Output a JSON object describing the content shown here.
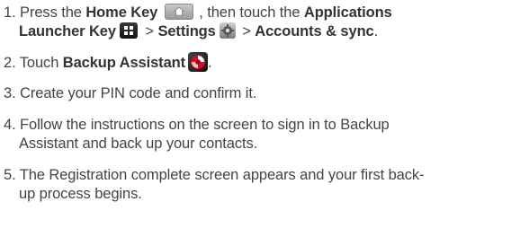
{
  "steps": [
    {
      "num": "1.",
      "pre": "Press the ",
      "home_key": "Home Key",
      "mid1": ", then touch the ",
      "apps_label": "Applications",
      "line2_apps": "Launcher Key",
      "sep1": " > ",
      "settings": "Settings",
      "sep2": " > ",
      "accounts": "Accounts & sync",
      "end": "."
    },
    {
      "num": "2.",
      "pre": "Touch ",
      "backup": "Backup Assistant",
      "end": "."
    },
    {
      "num": "3.",
      "text": "Create your PIN code and confirm it."
    },
    {
      "num": "4.",
      "line1": "Follow the instructions on the screen to sign in to Backup",
      "line2": "Assistant and back up your contacts."
    },
    {
      "num": "5.",
      "line1": "The Registration complete screen appears and your first back-",
      "line2": "up process begins."
    }
  ],
  "icons": {
    "home": "home-key-icon",
    "apps": "applications-launcher-key-icon",
    "settings": "settings-icon",
    "backup": "backup-assistant-icon"
  }
}
